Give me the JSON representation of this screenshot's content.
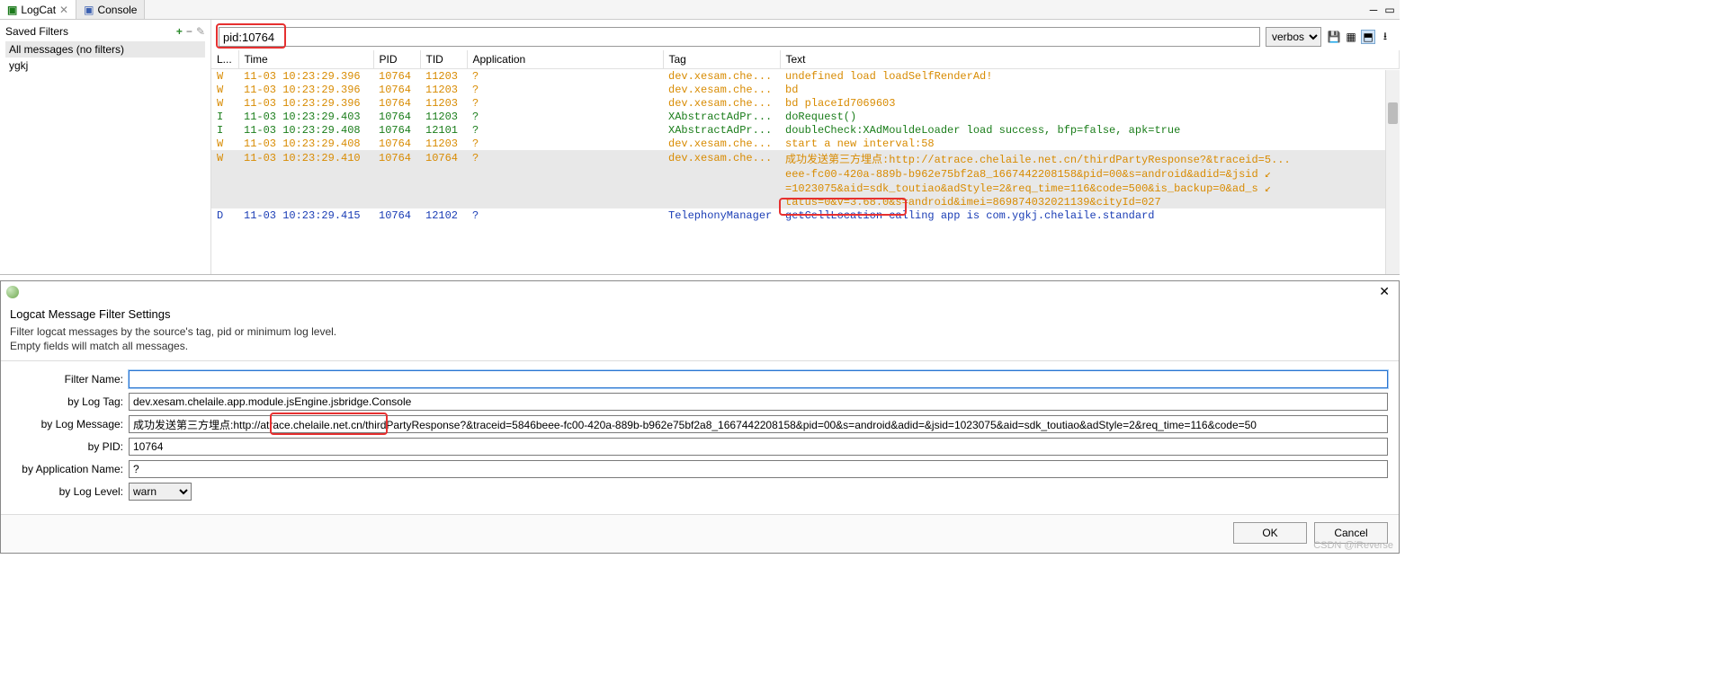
{
  "tabs": {
    "logcat": "LogCat",
    "console": "Console"
  },
  "sidebar": {
    "title": "Saved Filters",
    "items": [
      "All messages (no filters)",
      "ygkj"
    ]
  },
  "filterbox": {
    "value": "pid:10764"
  },
  "level_select": {
    "value": "verbose"
  },
  "columns": {
    "level": "L...",
    "time": "Time",
    "pid": "PID",
    "tid": "TID",
    "app": "Application",
    "tag": "Tag",
    "text": "Text"
  },
  "rows": [
    {
      "L": "W",
      "time": "11-03 10:23:29.396",
      "pid": "10764",
      "tid": "11203",
      "app": "?",
      "tag": "dev.xesam.che...",
      "text": "undefined load loadSelfRenderAd!",
      "cls": "W"
    },
    {
      "L": "W",
      "time": "11-03 10:23:29.396",
      "pid": "10764",
      "tid": "11203",
      "app": "?",
      "tag": "dev.xesam.che...",
      "text": "bd",
      "cls": "W"
    },
    {
      "L": "W",
      "time": "11-03 10:23:29.396",
      "pid": "10764",
      "tid": "11203",
      "app": "?",
      "tag": "dev.xesam.che...",
      "text": "bd placeId7069603",
      "cls": "W"
    },
    {
      "L": "I",
      "time": "11-03 10:23:29.403",
      "pid": "10764",
      "tid": "11203",
      "app": "?",
      "tag": "XAbstractAdPr...",
      "text": "doRequest()",
      "cls": "I"
    },
    {
      "L": "I",
      "time": "11-03 10:23:29.408",
      "pid": "10764",
      "tid": "12101",
      "app": "?",
      "tag": "XAbstractAdPr...",
      "text": "doubleCheck:XAdMouldeLoader load success, bfp=false, apk=true",
      "cls": "I"
    },
    {
      "L": "W",
      "time": "11-03 10:23:29.408",
      "pid": "10764",
      "tid": "11203",
      "app": "?",
      "tag": "dev.xesam.che...",
      "text": "start a new interval:58",
      "cls": "W"
    },
    {
      "L": "W",
      "time": "11-03 10:23:29.410",
      "pid": "10764",
      "tid": "10764",
      "app": "?",
      "tag": "dev.xesam.che...",
      "text": "成功发送第三方埋点:http://atrace.chelaile.net.cn/thirdPartyResponse?&traceid=5...",
      "cls": "W",
      "sel": true,
      "wrap": [
        "eee-fc00-420a-889b-b962e75bf2a8_1667442208158&pid=00&s=android&adid=&jsid ↙",
        "=1023075&aid=sdk_toutiao&adStyle=2&req_time=116&code=500&is_backup=0&ad_s ↙",
        "tatus=0&v=3.68.0&s=android&imei=869874032021139&cityId=027"
      ]
    },
    {
      "L": "D",
      "time": "11-03 10:23:29.415",
      "pid": "10764",
      "tid": "12102",
      "app": "?",
      "tag": "TelephonyManager",
      "text": "getCellLocation calling app is com.ygkj.chelaile.standard",
      "cls": "D"
    }
  ],
  "dialog": {
    "title": "Logcat Message Filter Settings",
    "desc1": "Filter logcat messages by the source's tag, pid or minimum log level.",
    "desc2": "Empty fields will match all messages.",
    "labels": {
      "filter_name": "Filter Name:",
      "by_tag": "by Log Tag:",
      "by_msg": "by Log Message:",
      "by_pid": "by PID:",
      "by_app": "by Application Name:",
      "by_level": "by Log Level:"
    },
    "values": {
      "filter_name": "",
      "by_tag": "dev.xesam.chelaile.app.module.jsEngine.jsbridge.Console",
      "by_msg": "成功发送第三方埋点:http://atrace.chelaile.net.cn/thirdPartyResponse?&traceid=5846beee-fc00-420a-889b-b962e75bf2a8_1667442208158&pid=00&s=android&adid=&jsid=1023075&aid=sdk_toutiao&adStyle=2&req_time=116&code=50",
      "by_pid": "10764",
      "by_app": "?",
      "by_level": "warn"
    },
    "buttons": {
      "ok": "OK",
      "cancel": "Cancel"
    }
  },
  "watermark": "CSDN @iReverse"
}
